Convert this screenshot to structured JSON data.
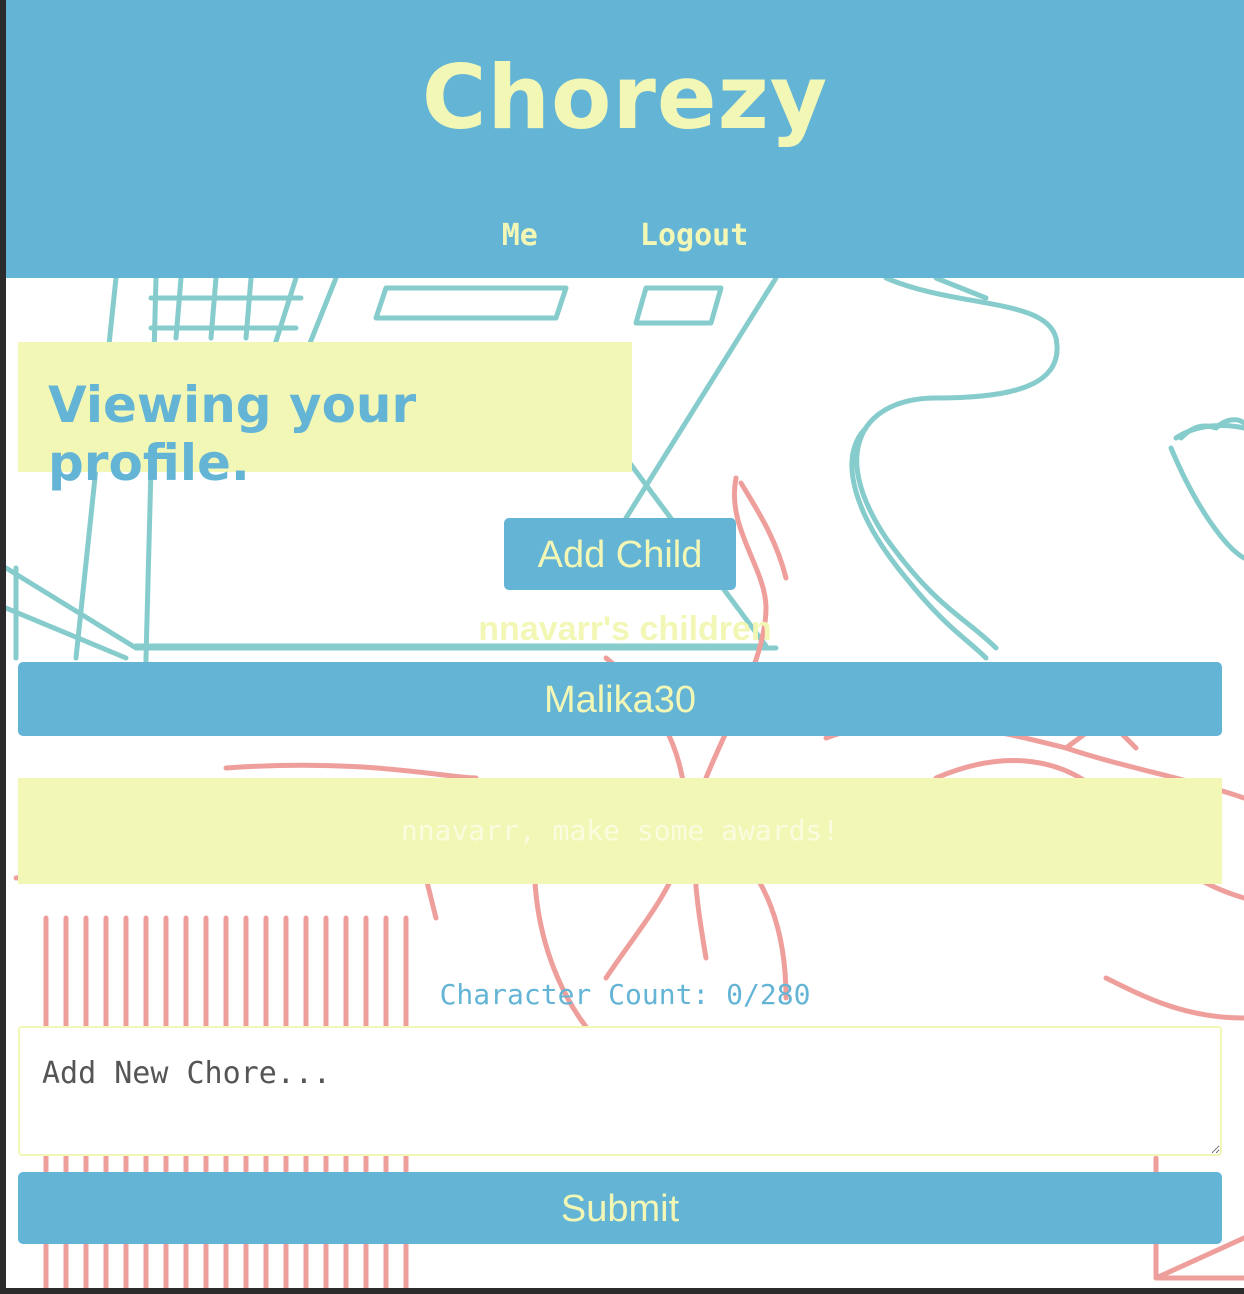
{
  "header": {
    "brand": "Chorezy",
    "nav": [
      "Me",
      "Logout"
    ]
  },
  "profile": {
    "title": "Viewing your profile."
  },
  "actions": {
    "add_child_label": "Add Child"
  },
  "children": {
    "heading": "nnavarr's children",
    "items": [
      "Malika30"
    ]
  },
  "awards": {
    "message": "nnavarr, make some awards!"
  },
  "chore_form": {
    "character_count": "Character Count: 0/280",
    "placeholder": "Add New Chore...",
    "submit_label": "Submit"
  },
  "colors": {
    "primary": "#64b4d6",
    "accent": "#f3f7b5",
    "doodle_teal": "#7ec9c9",
    "doodle_coral": "#ee9a96"
  }
}
